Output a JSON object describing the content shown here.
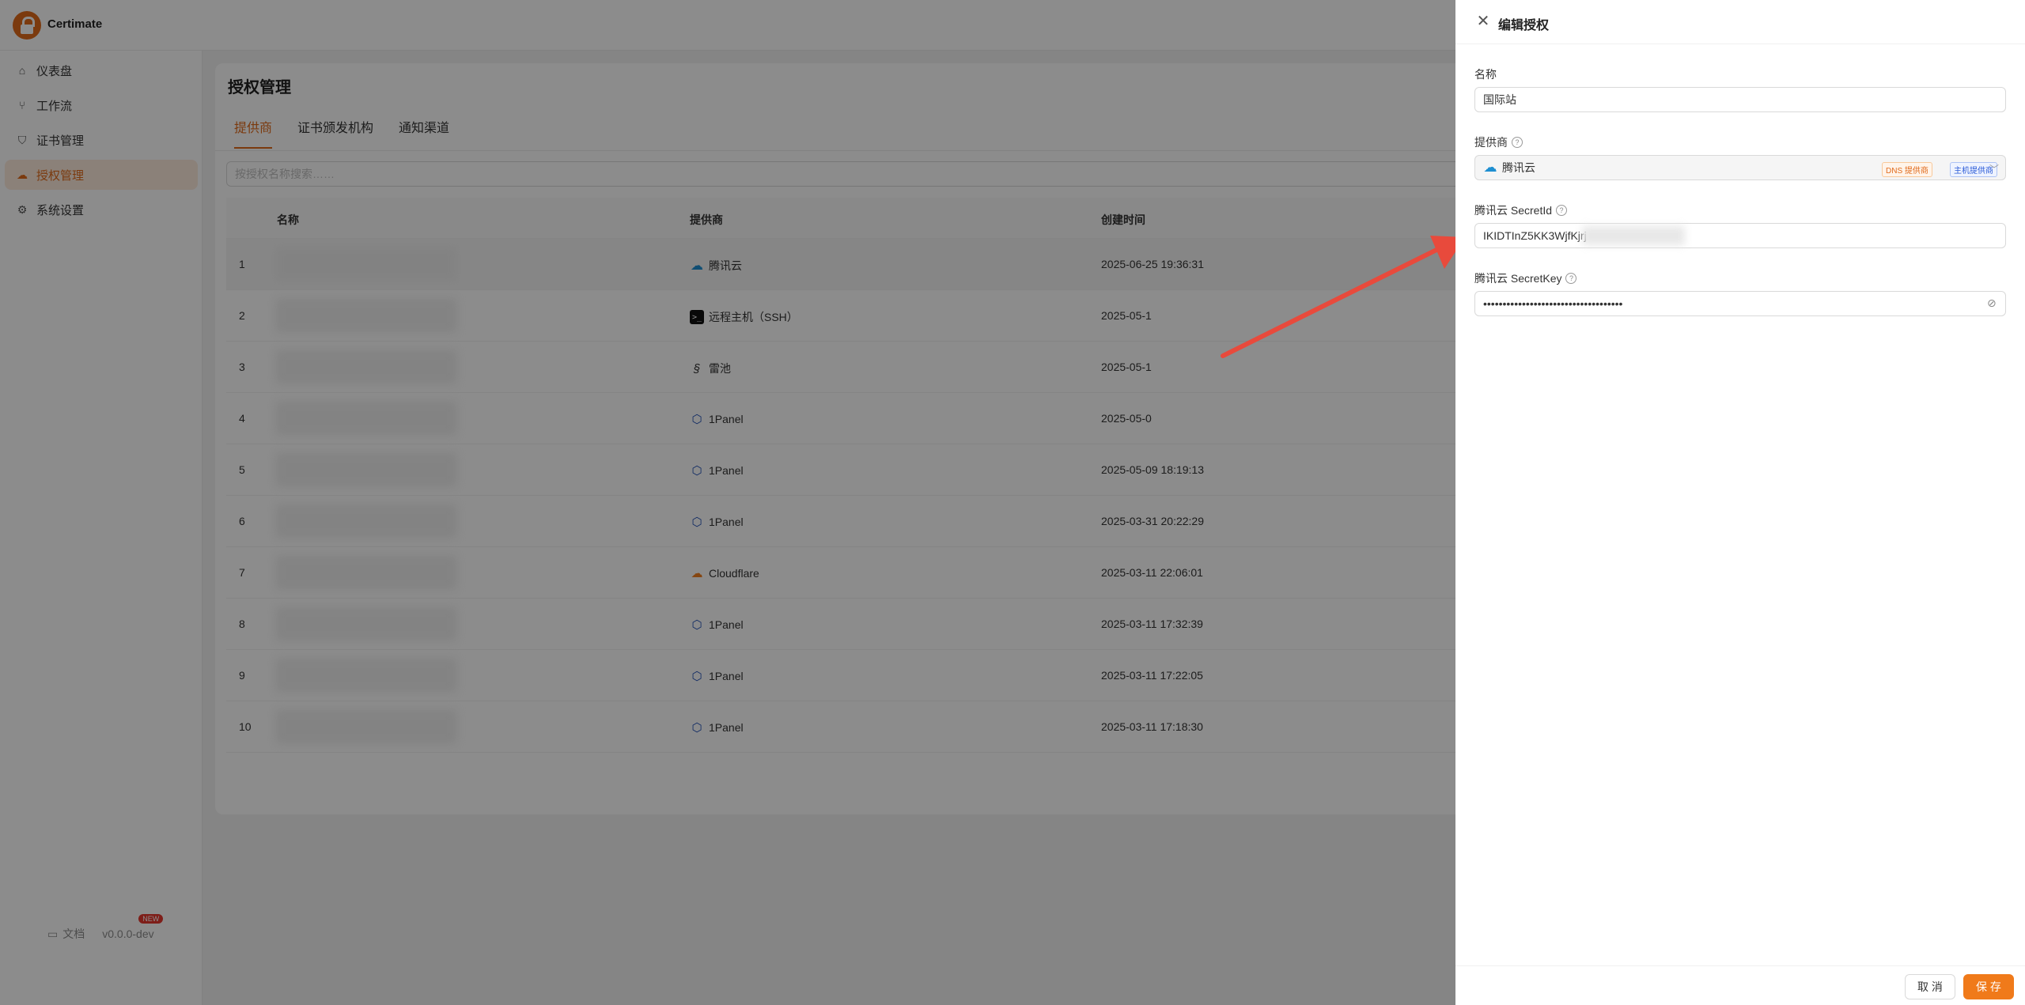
{
  "app": {
    "name": "Certimate",
    "accent": "#e06a1b"
  },
  "sidebar": {
    "items": [
      {
        "label": "仪表盘",
        "icon": "home-icon",
        "active": false
      },
      {
        "label": "工作流",
        "icon": "workflow-icon",
        "active": false
      },
      {
        "label": "证书管理",
        "icon": "shield-check-icon",
        "active": false
      },
      {
        "label": "授权管理",
        "icon": "cloud-icon",
        "active": true
      },
      {
        "label": "系统设置",
        "icon": "gear-icon",
        "active": false
      }
    ],
    "footer": {
      "docs_label": "文档",
      "version": "v0.0.0-dev",
      "new_badge": "NEW"
    }
  },
  "main": {
    "title": "授权管理",
    "tabs": [
      "提供商",
      "证书颁发机构",
      "通知渠道"
    ],
    "active_tab": 0,
    "search_placeholder": "按授权名称搜索……",
    "table": {
      "headers": [
        "名称",
        "提供商",
        "创建时间"
      ],
      "rows": [
        {
          "index": "1",
          "provider": "腾讯云",
          "provider_icon": "tencent-cloud-icon",
          "time": "2025-06-25 19:36:31"
        },
        {
          "index": "2",
          "provider": "远程主机（SSH）",
          "provider_icon": "terminal-icon",
          "time": "2025-05-1"
        },
        {
          "index": "3",
          "provider": "雷池",
          "provider_icon": "safeline-icon",
          "time": "2025-05-1"
        },
        {
          "index": "4",
          "provider": "1Panel",
          "provider_icon": "1panel-icon",
          "time": "2025-05-0"
        },
        {
          "index": "5",
          "provider": "1Panel",
          "provider_icon": "1panel-icon",
          "time": "2025-05-09 18:19:13"
        },
        {
          "index": "6",
          "provider": "1Panel",
          "provider_icon": "1panel-icon",
          "time": "2025-03-31 20:22:29"
        },
        {
          "index": "7",
          "provider": "Cloudflare",
          "provider_icon": "cloudflare-icon",
          "time": "2025-03-11 22:06:01"
        },
        {
          "index": "8",
          "provider": "1Panel",
          "provider_icon": "1panel-icon",
          "time": "2025-03-11 17:32:39"
        },
        {
          "index": "9",
          "provider": "1Panel",
          "provider_icon": "1panel-icon",
          "time": "2025-03-11 17:22:05"
        },
        {
          "index": "10",
          "provider": "1Panel",
          "provider_icon": "1panel-icon",
          "time": "2025-03-11 17:18:30"
        }
      ]
    }
  },
  "drawer": {
    "title": "编辑授权",
    "fields": {
      "name_label": "名称",
      "name_value": "国际站",
      "provider_label": "提供商",
      "provider_value": "腾讯云",
      "provider_tags": [
        "DNS 提供商",
        "主机提供商"
      ],
      "secret_id_label": "腾讯云 SecretId",
      "secret_id_value": "IKIDTInZ5KK3WjfKjrj",
      "secret_key_label": "腾讯云 SecretKey",
      "secret_key_value": "••••••••••••••••••••••••••••••••••••"
    },
    "buttons": {
      "cancel": "取 消",
      "save": "保 存"
    }
  },
  "colors": {
    "arrow": "#e84a3c",
    "save_button": "#f07a1a"
  }
}
